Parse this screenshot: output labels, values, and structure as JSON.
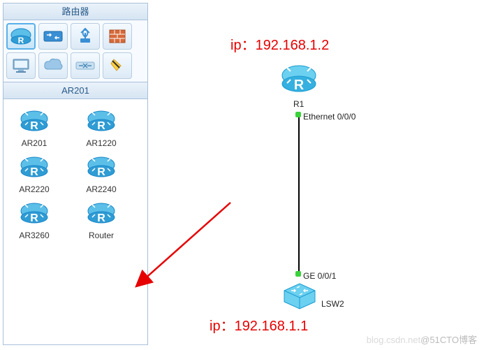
{
  "sidebar": {
    "title": "路由器",
    "categories": [
      {
        "name": "router-category",
        "selected": true
      },
      {
        "name": "switch-category",
        "selected": false
      },
      {
        "name": "wlan-category",
        "selected": false
      },
      {
        "name": "firewall-category",
        "selected": false
      },
      {
        "name": "pc-category",
        "selected": false
      },
      {
        "name": "cloud-category",
        "selected": false
      },
      {
        "name": "connection-category",
        "selected": false
      },
      {
        "name": "custom-category",
        "selected": false
      }
    ],
    "selected_model": "AR201",
    "devices": [
      {
        "label": "AR201"
      },
      {
        "label": "AR1220"
      },
      {
        "label": "AR2220"
      },
      {
        "label": "AR2240"
      },
      {
        "label": "AR3260"
      },
      {
        "label": "Router"
      }
    ]
  },
  "canvas": {
    "ip_top": "ip：192.168.1.2",
    "ip_bottom": "ip：192.168.1.1",
    "node_r1": "R1",
    "node_lsw2": "LSW2",
    "port_top": "Ethernet 0/0/0",
    "port_bottom": "GE 0/0/1"
  },
  "watermark": {
    "faint": "blog.csdn.net",
    "tag": "@51CTO博客"
  },
  "colors": {
    "router_blue": "#5bbfe8",
    "router_dark": "#1a86c8",
    "accent_red": "#e60000",
    "link_green": "#3bd23b"
  }
}
